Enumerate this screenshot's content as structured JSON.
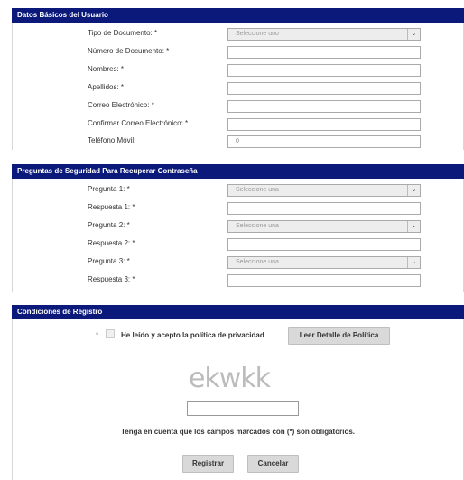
{
  "basic": {
    "title": "Datos Básicos del Usuario",
    "fields": [
      {
        "label": "Tipo de Documento: *",
        "value": "Seleccione uno"
      },
      {
        "label": "Número de Documento: *",
        "value": ""
      },
      {
        "label": "Nombres: *",
        "value": ""
      },
      {
        "label": "Apellidos: *",
        "value": ""
      },
      {
        "label": "Correo Electrónico: *",
        "value": ""
      },
      {
        "label": "Confirmar Correo Electrónico: *",
        "value": ""
      },
      {
        "label": "Teléfono Móvil:",
        "value": "0"
      }
    ]
  },
  "security": {
    "title": "Preguntas de Seguridad Para Recuperar Contraseña",
    "fields": [
      {
        "label": "Pregunta 1: *",
        "value": "Seleccione una"
      },
      {
        "label": "Respuesta 1: *",
        "value": ""
      },
      {
        "label": "Pregunta 2: *",
        "value": "Seleccione una"
      },
      {
        "label": "Respuesta 2: *",
        "value": ""
      },
      {
        "label": "Pregunta 3: *",
        "value": "Seleccione una"
      },
      {
        "label": "Respuesta 3: *",
        "value": ""
      }
    ]
  },
  "conditions": {
    "title": "Condiciones de Registro",
    "required_mark": "*",
    "privacy_label": "He leído y acepto la política de privacidad",
    "privacy_button": "Leer Detalle de Política",
    "captcha_text": "ekwkk",
    "captcha_value": "",
    "note": "Tenga en cuenta que los campos marcados con (*) son obligatorios.",
    "register_button": "Registrar",
    "cancel_button": "Cancelar"
  },
  "icons": {
    "dropdown": "chevron-down-icon"
  }
}
